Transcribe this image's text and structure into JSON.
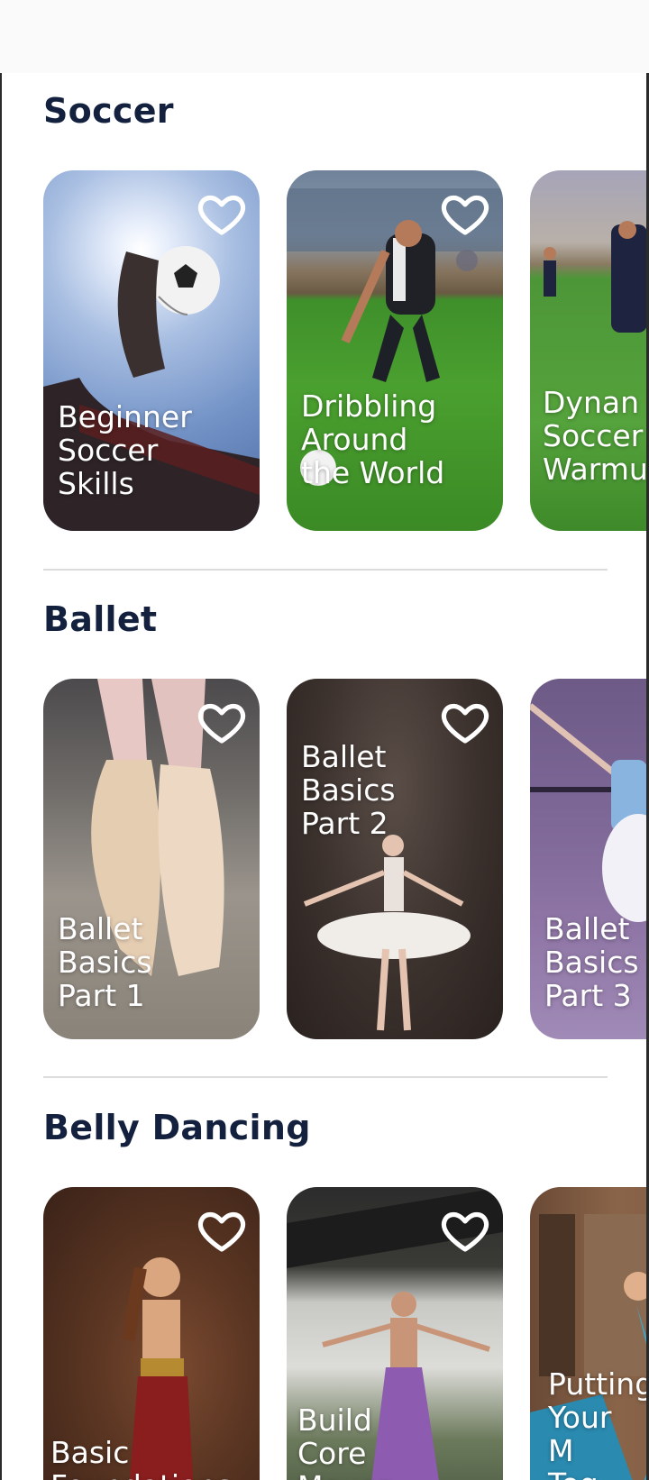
{
  "sections": [
    {
      "title": "Soccer",
      "cards": [
        {
          "title": "Beginner\nSoccer\nSkills",
          "favorite_icon": "heart-outline-icon"
        },
        {
          "title": "Dribbling\n        Around\nthe World",
          "favorite_icon": "heart-outline-icon"
        },
        {
          "title": "Dynan\nSoccer\nWarmu",
          "favorite_icon": "heart-outline-icon"
        }
      ]
    },
    {
      "title": "Ballet",
      "cards": [
        {
          "title": "Ballet\nBasics\nPart 1",
          "favorite_icon": "heart-outline-icon"
        },
        {
          "title": "Ballet\nBasics\n     Part 2",
          "favorite_icon": "heart-outline-icon"
        },
        {
          "title": "Ballet\nBasics\nPart 3",
          "favorite_icon": "heart-outline-icon"
        }
      ]
    },
    {
      "title": "Belly Dancing",
      "cards": [
        {
          "title": "Basic\nFoundations",
          "favorite_icon": "heart-outline-icon"
        },
        {
          "title": "Build\nCore\nMoves",
          "favorite_icon": "heart-outline-icon"
        },
        {
          "title": "Putting\nYour\nM\nTog",
          "favorite_icon": "heart-outline-icon"
        }
      ]
    }
  ],
  "colors": {
    "heading": "#13213f",
    "card_text": "#ffffff",
    "divider": "#dcdcdc"
  }
}
